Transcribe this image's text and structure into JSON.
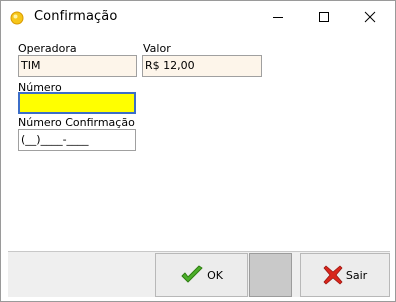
{
  "window": {
    "title": "Confirmação"
  },
  "form": {
    "operadora_label": "Operadora",
    "operadora_value": "TIM",
    "valor_label": "Valor",
    "valor_value": "R$ 12,00",
    "numero_label": "Número",
    "numero_value": "",
    "numero_confirmacao_label": "Número Confirmação",
    "numero_confirmacao_mask": "(__)____-____"
  },
  "buttons": {
    "ok_label": "OK",
    "sair_label": "Sair"
  },
  "colors": {
    "active_field": "#ffff00",
    "readonly_field": "#fdf5ea",
    "ok_icon": "#4caf2a",
    "exit_icon": "#d9261c"
  },
  "icons": {
    "app": "yellow-circle-icon",
    "minimize": "minimize-icon",
    "maximize": "maximize-icon",
    "close": "close-icon",
    "ok": "checkmark-icon",
    "exit": "red-x-icon"
  }
}
